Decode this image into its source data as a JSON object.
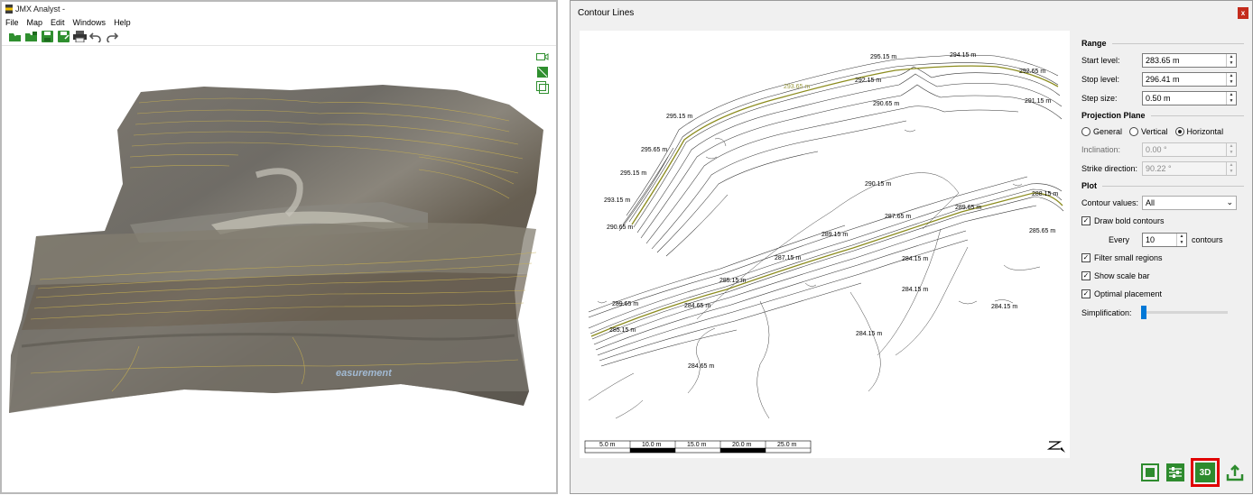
{
  "left_window": {
    "title": "JMX Analyst -",
    "menu": [
      "File",
      "Map",
      "Edit",
      "Windows",
      "Help"
    ],
    "toolbar_icons": [
      "open-folder-icon",
      "open-project-icon",
      "save-icon",
      "save-as-icon",
      "print-icon",
      "undo-icon",
      "redo-icon"
    ],
    "view_icons": [
      "camera-icon",
      "section-icon",
      "frame-icon"
    ],
    "watermark": "easurement"
  },
  "contour_window": {
    "title": "Contour Lines",
    "close_label": "x",
    "range": {
      "heading": "Range",
      "start_label": "Start level:",
      "start_value": "283.65 m",
      "stop_label": "Stop level:",
      "stop_value": "296.41 m",
      "step_label": "Step size:",
      "step_value": "0.50 m"
    },
    "projection": {
      "heading": "Projection Plane",
      "options": [
        "General",
        "Vertical",
        "Horizontal"
      ],
      "selected": "Horizontal",
      "inclination_label": "Inclination:",
      "inclination_value": "0.00 °",
      "strike_label": "Strike direction:",
      "strike_value": "90.22 °"
    },
    "plot": {
      "heading": "Plot",
      "contour_values_label": "Contour values:",
      "contour_values": "All",
      "draw_bold_label": "Draw bold contours",
      "every_label": "Every",
      "every_value": "10",
      "contours_label": "contours",
      "filter_label": "Filter small regions",
      "scale_label": "Show scale bar",
      "placement_label": "Optimal placement",
      "simplification_label": "Simplification:",
      "simplification_level": 0
    },
    "contour_labels": [
      "295.15 m",
      "294.15 m",
      "292.65 m",
      "293.65 m",
      "292.15 m",
      "290.65 m",
      "291.15 m",
      "295.15 m",
      "295.65 m",
      "295.15 m",
      "293.15 m",
      "290.65 m",
      "290.15 m",
      "288.15 m",
      "287.65 m",
      "289.65 m",
      "289.15 m",
      "285.65 m",
      "287.15 m",
      "284.15 m",
      "285.15 m",
      "289.65 m",
      "284.65 m",
      "284.15 m",
      "284.15 m",
      "285.15 m",
      "284.15 m",
      "284.65 m"
    ],
    "scale_bar": [
      "5.0 m",
      "10.0 m",
      "15.0 m",
      "20.0 m",
      "25.0 m"
    ],
    "colors": {
      "bold_contour": "#8c8c1e",
      "accent_green": "#2e8b2e",
      "highlight": "#e00000"
    },
    "bottom_buttons": [
      "fit-view-icon",
      "settings-sliders-icon",
      "3D",
      "export-icon"
    ]
  }
}
